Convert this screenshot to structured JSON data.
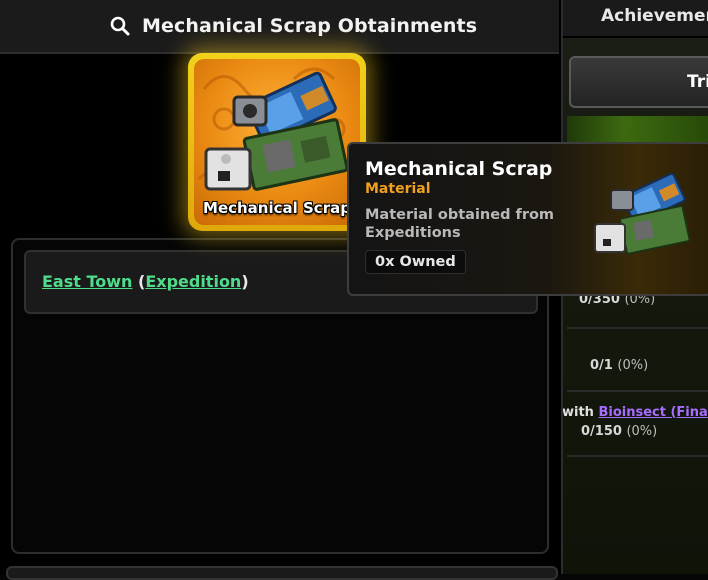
{
  "modal": {
    "title": "Mechanical Scrap Obtainments",
    "search_icon": "search-icon"
  },
  "item": {
    "name": "Mechanical Scrap",
    "icon": "mechanical-scrap-icon",
    "slot_color": "#f2d21a"
  },
  "tooltip": {
    "title": "Mechanical Scrap",
    "type": "Material",
    "description": "Material obtained from Expeditions",
    "owned": "0x Owned",
    "type_color": "#f0a020"
  },
  "sources": [
    {
      "location": "East Town",
      "open_paren": " (",
      "method": "Expedition",
      "close_paren": ")"
    }
  ],
  "background": {
    "panel_title": "Achievemer",
    "button_label": "Tri",
    "rows": [
      {
        "progress": "0/350",
        "pct": "(0%)"
      },
      {
        "progress": "0/1",
        "pct": "(0%)"
      },
      {
        "prefix": "with ",
        "highlight": "Bioinsect (Fina",
        "progress": "0/150",
        "pct": "(0%)"
      }
    ]
  }
}
